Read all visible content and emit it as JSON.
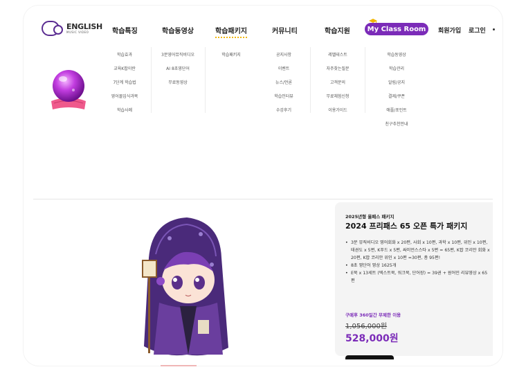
{
  "logo": {
    "text": "ENGLISH",
    "sub": "MUSIC VIDEO"
  },
  "nav": [
    {
      "label": "학습특징"
    },
    {
      "label": "학습동영상"
    },
    {
      "label": "학습패키지"
    },
    {
      "label": "커뮤니티"
    },
    {
      "label": "학습지원"
    }
  ],
  "my_class_room": "My Class Room",
  "util": {
    "signup": "회원가입",
    "login": "로그인"
  },
  "dropdown": {
    "col1": [
      "학습효과",
      "교육K팝이란",
      "7단계 학습법",
      "영어몰입식과목",
      "학습사례"
    ],
    "col2": [
      "3분영어뮤직비디오",
      "AI 8초영단어",
      "무료동영상"
    ],
    "col3": [
      "학습패키지"
    ],
    "col4": [
      "공지사항",
      "이벤트",
      "뉴스/언론",
      "학습인터뷰",
      "수강후기"
    ],
    "col5": [
      "레벨테스트",
      "자주찾는질문",
      "고객문의",
      "무료체험신청",
      "이용가이드"
    ],
    "col6": [
      "학습동영상",
      "학습관리",
      "알림/공지",
      "결제/쿠폰",
      "애플/포인트",
      "친구추천안내"
    ]
  },
  "card": {
    "eyebrow": "2025년형 올패스 패키지",
    "title": "2024 프리패스 65 오픈 특가 패키지",
    "items": [
      "3분 뮤직비디오 영어회화 x 20편, 사회 x 10편, 과학 x 10편, 위인 x 10편, 태권도 x 5편, K푸드 x 5편, 싸이언스스타 x 5편 = 65편, K팝 코리안 회화 x 20편, K팝 코리안 위인 x 10편 =30편, 총 95편!",
      "8초 영단어 영상 1625개",
      "E북 x 13세트 (텍스트북, 워크북, 단어장) = 39권 + 원어민 리뷰영상 x 65편"
    ],
    "note": "구매후 360일간 무제한 이용",
    "old_price": "1,056,000원",
    "price": "528,000원"
  },
  "colors": {
    "accent": "#7b2bb8",
    "underline": "#f2b600"
  }
}
